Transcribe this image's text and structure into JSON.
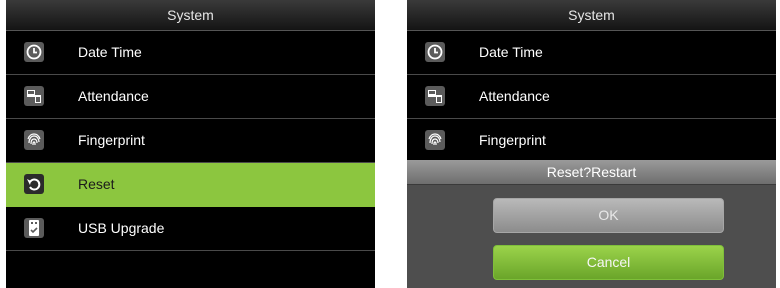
{
  "screens": [
    {
      "title": "System",
      "items": [
        {
          "label": "Date Time",
          "icon": "clock-icon"
        },
        {
          "label": "Attendance",
          "icon": "attendance-icon"
        },
        {
          "label": "Fingerprint",
          "icon": "fingerprint-icon"
        },
        {
          "label": "Reset",
          "icon": "reset-icon",
          "selected": true
        },
        {
          "label": "USB Upgrade",
          "icon": "usb-drive-icon"
        }
      ]
    },
    {
      "title": "System",
      "items": [
        {
          "label": "Date Time",
          "icon": "clock-icon"
        },
        {
          "label": "Attendance",
          "icon": "attendance-icon"
        },
        {
          "label": "Fingerprint",
          "icon": "fingerprint-icon"
        }
      ],
      "dialog": {
        "title": "Reset?Restart",
        "ok_label": "OK",
        "cancel_label": "Cancel"
      }
    }
  ],
  "colors": {
    "selected_bg": "#8cc63f",
    "cancel_green": "#7fbf3a",
    "screen_bg": "#000000"
  }
}
